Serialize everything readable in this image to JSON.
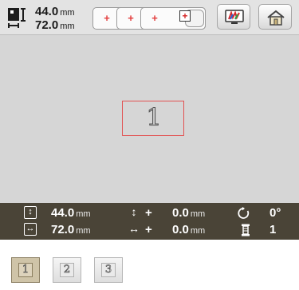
{
  "size": {
    "width_value": "44.0",
    "height_value": "72.0",
    "unit": "mm"
  },
  "hoop_plus": "+",
  "status": {
    "height_value": "44.0",
    "width_value": "72.0",
    "move_v_value": "0.0",
    "move_h_value": "0.0",
    "unit": "mm",
    "move_v_sign": "+",
    "move_h_sign": "+",
    "rotation": "0°",
    "color_count": "1"
  },
  "canvas": {
    "glyph": "1"
  },
  "tabs": [
    {
      "label": "1",
      "active": true
    },
    {
      "label": "2",
      "active": false
    },
    {
      "label": "3",
      "active": false
    }
  ],
  "colors": {
    "status_bar": "#4a4437",
    "selection_border": "#e25252",
    "accent_red": "#e23b3b"
  }
}
